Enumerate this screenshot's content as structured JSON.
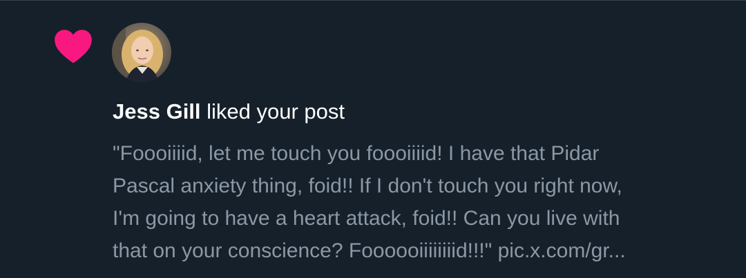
{
  "notification": {
    "type_icon": "heart-icon",
    "accent_color": "#f91880",
    "user_name": "Jess Gill",
    "action_text": " liked your post",
    "post_lines": [
      "\"Foooiiiid, let me touch you foooiiiid! I have that Pidar",
      "Pascal anxiety thing, foid!! If I don't touch you right now,",
      "I'm going to have a heart attack, foid!! Can you live with",
      "that on your conscience? Foooooiiiiiiiid!!!\" pic.x.com/gr..."
    ]
  }
}
